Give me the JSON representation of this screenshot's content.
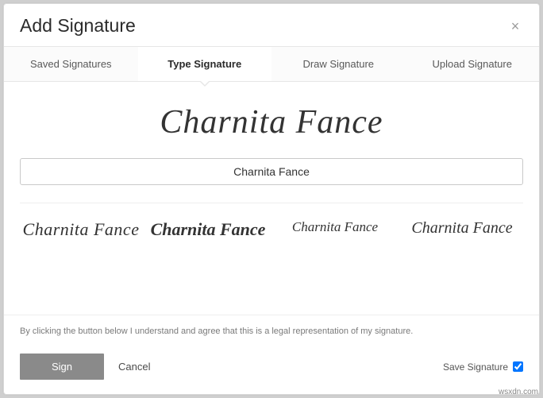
{
  "header": {
    "title": "Add Signature"
  },
  "tabs": {
    "saved": "Saved Signatures",
    "type": "Type Signature",
    "draw": "Draw Signature",
    "upload": "Upload Signature"
  },
  "signature": {
    "preview_text": "Charnita Fance",
    "input_value": "Charnita Fance",
    "samples": {
      "s1": "Charnita Fance",
      "s2": "Charnita Fance",
      "s3": "Charnita Fance",
      "s4": "Charnita Fance"
    }
  },
  "legal_text": "By clicking the button below I understand and agree that this is a legal representation of my signature.",
  "footer": {
    "sign": "Sign",
    "cancel": "Cancel",
    "save_label": "Save Signature",
    "save_checked": true
  },
  "watermark": "wsxdn.com"
}
